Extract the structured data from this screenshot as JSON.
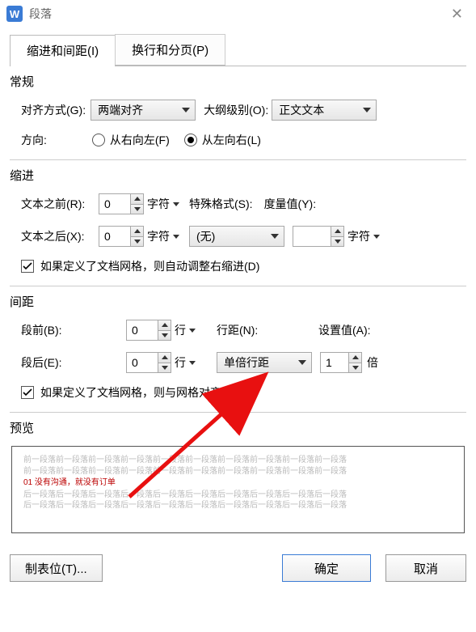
{
  "title": "段落",
  "tabs": {
    "indent": "缩进和间距(I)",
    "pagination": "换行和分页(P)"
  },
  "general": {
    "heading": "常规",
    "align_label": "对齐方式(G):",
    "align_value": "两端对齐",
    "outline_label": "大纲级别(O):",
    "outline_value": "正文文本",
    "direction_label": "方向:",
    "rtl_label": "从右向左(F)",
    "ltr_label": "从左向右(L)"
  },
  "indent": {
    "heading": "缩进",
    "before_label": "文本之前(R):",
    "before_value": "0",
    "after_label": "文本之后(X):",
    "after_value": "0",
    "unit_char": "字符",
    "special_label": "特殊格式(S):",
    "special_value": "(无)",
    "measure_label": "度量值(Y):",
    "measure_value": "",
    "measure_unit": "字符",
    "grid_checkbox": "如果定义了文档网格，则自动调整右缩进(D)"
  },
  "spacing": {
    "heading": "间距",
    "before_label": "段前(B):",
    "before_value": "0",
    "after_label": "段后(E):",
    "after_value": "0",
    "unit_line": "行",
    "linespacing_label": "行距(N):",
    "linespacing_value": "单倍行距",
    "setvalue_label": "设置值(A):",
    "setvalue_value": "1",
    "setvalue_unit": "倍",
    "grid_checkbox": "如果定义了文档网格，则与网格对齐(W)"
  },
  "preview": {
    "heading": "预览",
    "line_before": "前一段落前一段落前一段落前一段落前一段落前一段落前一段落前一段落前一段落前一段落",
    "sample_text": "01 没有沟通，就没有订单",
    "line_after": "后一段落后一段落后一段落后一段落后一段落后一段落后一段落后一段落后一段落后一段落"
  },
  "buttons": {
    "tabstops": "制表位(T)...",
    "ok": "确定",
    "cancel": "取消"
  }
}
